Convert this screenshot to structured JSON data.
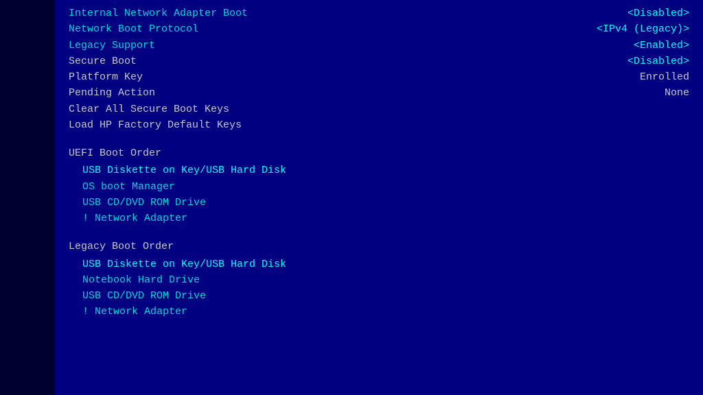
{
  "bios": {
    "rows": [
      {
        "label": "Internal Network Adapter Boot",
        "value": "<Disabled>",
        "labelColor": "cyan",
        "valueColor": "cyan"
      },
      {
        "label": "Network Boot Protocol",
        "value": "<IPv4 (Legacy)>",
        "labelColor": "cyan",
        "valueColor": "cyan"
      },
      {
        "label": "Legacy Support",
        "value": "<Enabled>",
        "labelColor": "cyan",
        "valueColor": "cyan"
      },
      {
        "label": "Secure Boot",
        "value": "<Disabled>",
        "labelColor": "gray",
        "valueColor": "cyan"
      },
      {
        "label": "Platform Key",
        "value": "Enrolled",
        "labelColor": "gray",
        "valueColor": "gray"
      },
      {
        "label": "Pending Action",
        "value": "None",
        "labelColor": "gray",
        "valueColor": "gray"
      },
      {
        "label": "Clear All Secure Boot Keys",
        "value": "",
        "labelColor": "gray",
        "valueColor": ""
      },
      {
        "label": "Load HP Factory Default Keys",
        "value": "",
        "labelColor": "gray",
        "valueColor": ""
      }
    ],
    "uefi_section": "UEFI Boot Order",
    "uefi_items": [
      {
        "text": "USB Diskette on Key/USB Hard Disk",
        "highlight": true
      },
      {
        "text": "OS boot Manager",
        "highlight": false
      },
      {
        "text": "USB CD/DVD ROM Drive",
        "highlight": false
      },
      {
        "text": "! Network Adapter",
        "highlight": false
      }
    ],
    "legacy_section": "Legacy Boot Order",
    "legacy_items": [
      {
        "text": "USB Diskette on Key/USB Hard Disk",
        "highlight": true
      },
      {
        "text": "Notebook Hard Drive",
        "highlight": false
      },
      {
        "text": "USB CD/DVD ROM Drive",
        "highlight": false
      },
      {
        "text": "! Network Adapter",
        "highlight": false
      }
    ]
  }
}
